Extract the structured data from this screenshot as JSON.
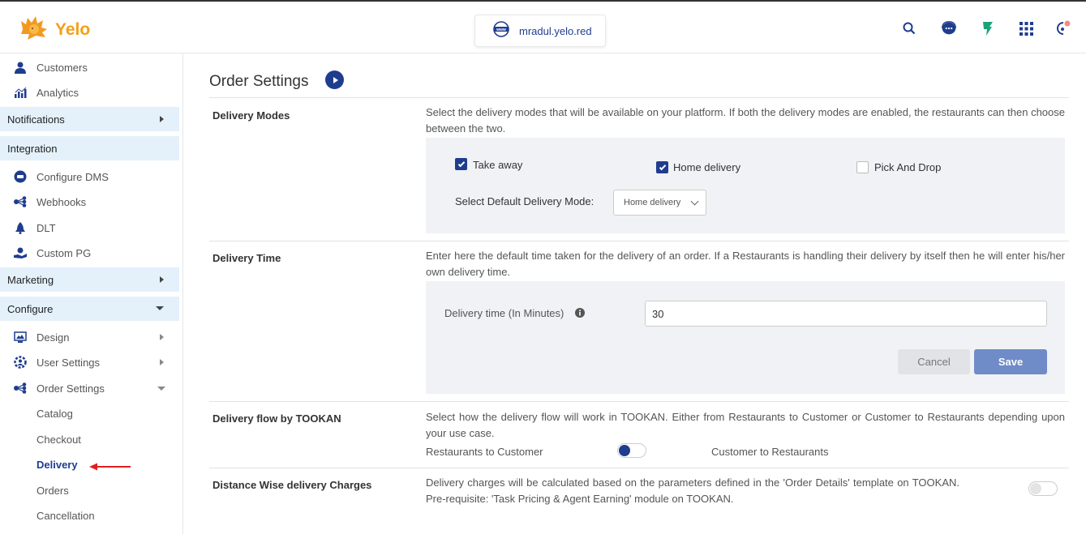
{
  "header": {
    "brand": "Yelo",
    "domain": "mradul.yelo.red",
    "icons": [
      "search-icon",
      "support-chat-icon",
      "tookan-icon",
      "apps-grid-icon",
      "profile-icon"
    ]
  },
  "sidebar": {
    "top_items": [
      {
        "label": "Customers",
        "icon": "customers-icon"
      },
      {
        "label": "Analytics",
        "icon": "analytics-icon"
      }
    ],
    "sections": {
      "notifications": "Notifications",
      "integration": "Integration",
      "marketing": "Marketing",
      "configure": "Configure"
    },
    "integration_items": [
      {
        "label": "Configure DMS",
        "icon": "dms-icon"
      },
      {
        "label": "Webhooks",
        "icon": "webhooks-icon"
      },
      {
        "label": "DLT",
        "icon": "dlt-icon"
      },
      {
        "label": "Custom PG",
        "icon": "payment-gateway-icon"
      }
    ],
    "configure_items": [
      {
        "label": "Design",
        "icon": "design-icon"
      },
      {
        "label": "User Settings",
        "icon": "user-settings-icon"
      },
      {
        "label": "Order Settings",
        "icon": "order-settings-icon"
      }
    ],
    "order_settings_subitems": [
      "Catalog",
      "Checkout",
      "Delivery",
      "Orders",
      "Cancellation"
    ],
    "active_subitem": "Delivery"
  },
  "main": {
    "title": "Order Settings",
    "delivery_modes": {
      "label": "Delivery Modes",
      "description": "Select the delivery modes that will be available on your platform. If both the delivery modes are enabled, the restaurants can then choose between the two.",
      "options": [
        {
          "label": "Take away",
          "checked": true
        },
        {
          "label": "Home delivery",
          "checked": true
        },
        {
          "label": "Pick And Drop",
          "checked": false
        }
      ],
      "default_label": "Select Default Delivery Mode:",
      "default_value": "Home delivery"
    },
    "delivery_time": {
      "label": "Delivery Time",
      "description": "Enter here the default time taken for the delivery of an order. If a Restaurants is handling their delivery by itself then he will enter his/her own delivery time.",
      "field_label": "Delivery time (In Minutes)",
      "field_value": "30",
      "cancel_label": "Cancel",
      "save_label": "Save"
    },
    "delivery_flow": {
      "label": "Delivery flow by TOOKAN",
      "description": "Select how the delivery flow will work in TOOKAN. Either from Restaurants to Customer or Customer to Restaurants depending upon your use case.",
      "left_option": "Restaurants to Customer",
      "right_option": "Customer to Restaurants",
      "selected": "Restaurants to Customer"
    },
    "distance_charges": {
      "label": "Distance Wise delivery Charges",
      "description": "Delivery charges will be calculated based on the parameters defined in the 'Order Details' template on TOOKAN. Pre-requisite: 'Task Pricing & Agent Earning' module on TOOKAN.",
      "enabled": false
    }
  },
  "colors": {
    "brand": "#f2a019",
    "primary": "#1f3d8f",
    "section_bg": "#e4f1fb",
    "panel_bg": "#f1f2f5",
    "save_button": "#6f8bc8",
    "annotation_arrow": "#e02020"
  }
}
